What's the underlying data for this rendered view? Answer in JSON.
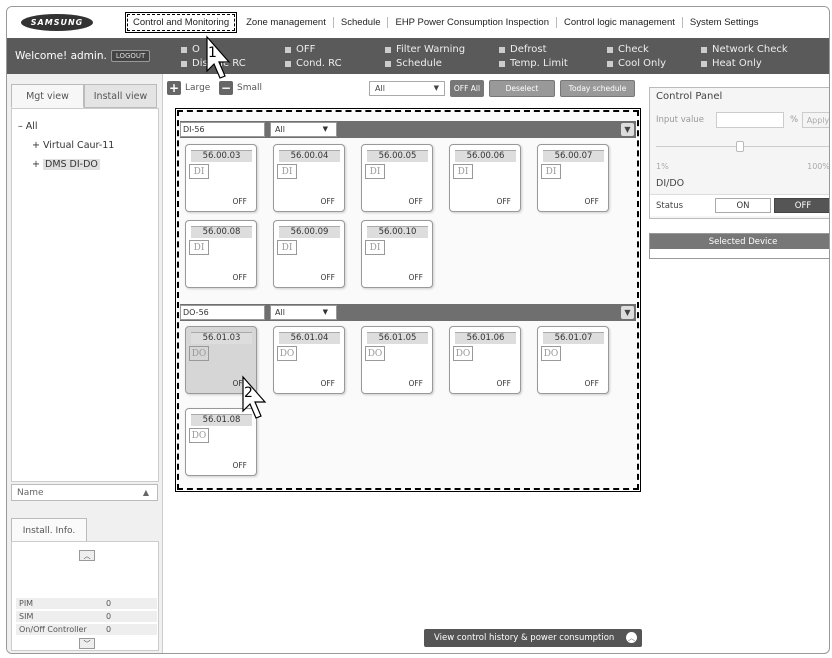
{
  "brand": "SAMSUNG",
  "nav": [
    {
      "label": "Control and Monitoring",
      "active": true
    },
    {
      "label": "Zone management"
    },
    {
      "label": "Schedule"
    },
    {
      "label": "EHP Power Consumption Inspection"
    },
    {
      "label": "Control logic management"
    },
    {
      "label": "System Settings"
    }
  ],
  "status": {
    "welcome": "Welcome! admin.",
    "logout": "LOGOUT",
    "items": [
      "OFF",
      "Filter Warning",
      "Defrost",
      "Check",
      "Network Check",
      "Disable RC",
      "Cond. RC",
      "Schedule",
      "Temp. Limit",
      "Cool Only",
      "Heat Only"
    ],
    "partial_first": "O"
  },
  "left": {
    "tabs": [
      "Mgt view",
      "Install view"
    ],
    "tree": {
      "root": "All",
      "children": [
        "Virtual Caur-11",
        "DMS DI-DO"
      ],
      "root_expander": "–",
      "child_expander": "+"
    },
    "name_select": "Name",
    "install_tab": "Install. Info.",
    "install_rows": [
      {
        "k": "PIM",
        "v": "0"
      },
      {
        "k": "SIM",
        "v": "0"
      },
      {
        "k": "On/Off Controller",
        "v": "0"
      }
    ]
  },
  "toolbar": {
    "large": "Large",
    "small": "Small",
    "filter": "All",
    "off_all": "OFF All",
    "deselect": "Deselect",
    "today_schedule": "Today schedule"
  },
  "groups": [
    {
      "name": "DI-56",
      "filter": "All",
      "devices": [
        {
          "id": "56.00.03",
          "type": "DI",
          "state": "OFF"
        },
        {
          "id": "56.00.04",
          "type": "DI",
          "state": "OFF"
        },
        {
          "id": "56.00.05",
          "type": "DI",
          "state": "OFF"
        },
        {
          "id": "56.00.06",
          "type": "DI",
          "state": "OFF"
        },
        {
          "id": "56.00.07",
          "type": "DI",
          "state": "OFF"
        },
        {
          "id": "56.00.08",
          "type": "DI",
          "state": "OFF"
        },
        {
          "id": "56.00.09",
          "type": "DI",
          "state": "OFF"
        },
        {
          "id": "56.00.10",
          "type": "DI",
          "state": "OFF"
        }
      ]
    },
    {
      "name": "DO-56",
      "filter": "All",
      "devices": [
        {
          "id": "56.01.03",
          "type": "DO",
          "state": "OFF",
          "selected": true
        },
        {
          "id": "56.01.04",
          "type": "DO",
          "state": "OFF"
        },
        {
          "id": "56.01.05",
          "type": "DO",
          "state": "OFF"
        },
        {
          "id": "56.01.06",
          "type": "DO",
          "state": "OFF"
        },
        {
          "id": "56.01.07",
          "type": "DO",
          "state": "OFF"
        },
        {
          "id": "56.01.08",
          "type": "DO",
          "state": "OFF"
        }
      ]
    }
  ],
  "bottom_button": "View control history & power consumption",
  "control_panel": {
    "title": "Control Panel",
    "input_label": "Input value",
    "unit": "%",
    "apply": "Apply",
    "min": "1%",
    "max": "100%",
    "section": "DI/DO",
    "status_label": "Status",
    "on": "ON",
    "off": "OFF",
    "selected_device": "Selected Device",
    "slider_level_fraction": 0.5
  },
  "callouts": [
    "1",
    "2"
  ],
  "colors": {
    "status_bar": "#5a5a5a",
    "group_header": "#6f6f6f",
    "off_button": "#555555"
  }
}
